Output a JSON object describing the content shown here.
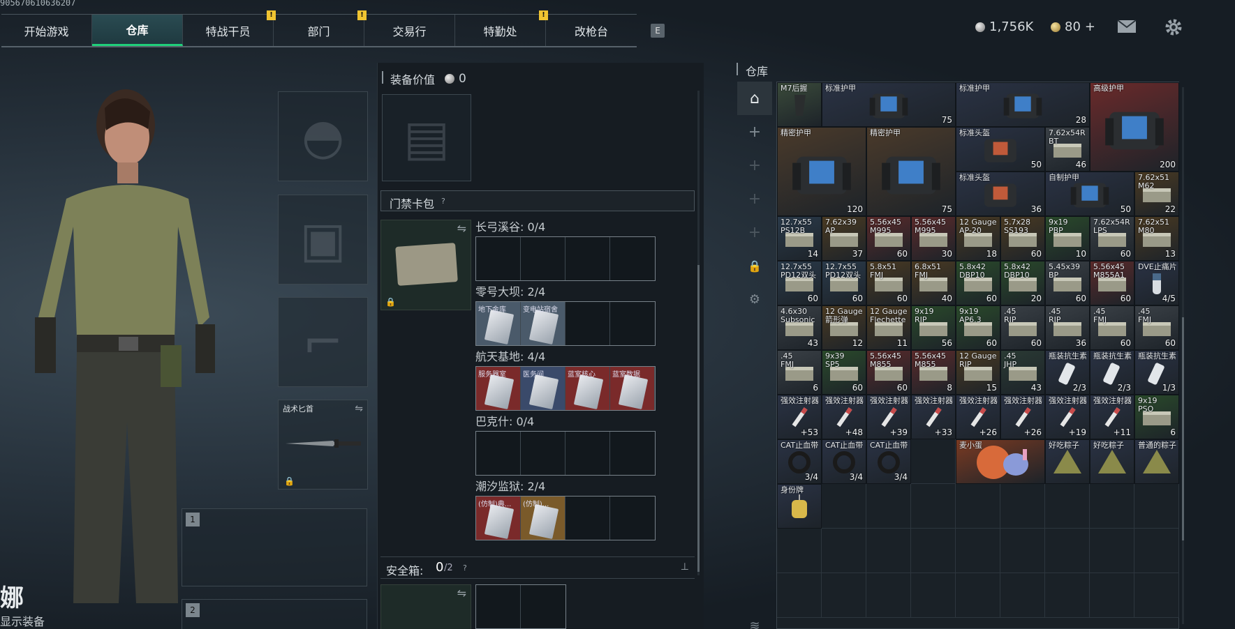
{
  "uid": "905670610636207",
  "tabs": [
    {
      "label": "开始游戏",
      "active": false,
      "alert": false
    },
    {
      "label": "仓库",
      "active": true,
      "alert": false
    },
    {
      "label": "特战干员",
      "active": false,
      "alert": true
    },
    {
      "label": "部门",
      "active": false,
      "alert": true
    },
    {
      "label": "交易行",
      "active": false,
      "alert": false
    },
    {
      "label": "特勤处",
      "active": false,
      "alert": true
    },
    {
      "label": "改枪台",
      "active": false,
      "alert": false
    }
  ],
  "key_hint": "E",
  "currency": {
    "silver": "1,756K",
    "gold": "80",
    "gold_add": "+"
  },
  "character": {
    "name_partial": "娜",
    "subtitle": "显示装备"
  },
  "gear": {
    "knife_label": "战术匕首",
    "weapon_slot_1": "1",
    "weapon_slot_2": "2"
  },
  "middle": {
    "equip_value_label": "装备价值",
    "equip_value": "0",
    "keycard_title": "门禁卡包",
    "help": "?",
    "maps": [
      {
        "label": "长弓溪谷: 0/4",
        "cards": []
      },
      {
        "label": "零号大坝: 2/4",
        "cards": [
          {
            "name": "地下金库",
            "color": "#4a5a6a"
          },
          {
            "name": "变电站宿舍",
            "color": "#4a5a6a"
          }
        ]
      },
      {
        "label": "航天基地: 4/4",
        "cards": [
          {
            "name": "服务器室",
            "color": "#7a2a2a"
          },
          {
            "name": "医务间",
            "color": "#3a4a6a"
          },
          {
            "name": "蓝室核心",
            "color": "#7a2a2a"
          },
          {
            "name": "蓝室数据",
            "color": "#7a2a2a"
          }
        ]
      },
      {
        "label": "巴克什: 0/4",
        "cards": []
      },
      {
        "label": "潮汐监狱: 2/4",
        "cards": [
          {
            "name": "(仿制)典...",
            "color": "#7a2a2a"
          },
          {
            "name": "(仿制)...",
            "color": "#7a5a2a"
          }
        ]
      }
    ],
    "safebox_label": "安全箱:",
    "safebox_value": "0",
    "safebox_total": "/2"
  },
  "warehouse": {
    "title": "仓库",
    "items": [
      {
        "name": "M7后握",
        "qty": "",
        "col": 0,
        "row": 0,
        "w": 1,
        "h": 1,
        "color": "#3a4a3a",
        "icon": "grip"
      },
      {
        "name": "标准护甲",
        "qty": "75",
        "col": 1,
        "row": 0,
        "w": 3,
        "h": 1,
        "color": "#2a3244",
        "icon": "armor"
      },
      {
        "name": "标准护甲",
        "qty": "28",
        "col": 4,
        "row": 0,
        "w": 3,
        "h": 1,
        "color": "#2a3244",
        "icon": "armor"
      },
      {
        "name": "高级护甲",
        "qty": "200",
        "col": 7,
        "row": 0,
        "w": 2,
        "h": 2,
        "color": "#6a2a2a",
        "icon": "armor"
      },
      {
        "name": "精密护甲",
        "qty": "120",
        "col": 0,
        "row": 1,
        "w": 2,
        "h": 2,
        "color": "#4a3a2a",
        "icon": "armor"
      },
      {
        "name": "精密护甲",
        "qty": "75",
        "col": 2,
        "row": 1,
        "w": 2,
        "h": 2,
        "color": "#4a3a2a",
        "icon": "armor"
      },
      {
        "name": "标准头盔",
        "qty": "50",
        "col": 4,
        "row": 1,
        "w": 2,
        "h": 1,
        "color": "#2a3244",
        "icon": "helmet"
      },
      {
        "name": "7.62x54R\nBT",
        "qty": "46",
        "col": 6,
        "row": 1,
        "w": 1,
        "h": 1,
        "color": "#3a4046",
        "icon": "ammo"
      },
      {
        "name": "标准头盔",
        "qty": "36",
        "col": 4,
        "row": 2,
        "w": 2,
        "h": 1,
        "color": "#2a3244",
        "icon": "helmet"
      },
      {
        "name": "自制护甲",
        "qty": "50",
        "col": 6,
        "row": 2,
        "w": 2,
        "h": 1,
        "color": "#2a3244",
        "icon": "armor"
      },
      {
        "name": "7.62x51\nM62",
        "qty": "22",
        "col": 8,
        "row": 2,
        "w": 1,
        "h": 1,
        "color": "#4a3a22",
        "icon": "ammo"
      },
      {
        "name": "12.7x55\nPS12B",
        "qty": "14",
        "col": 0,
        "row": 3,
        "w": 1,
        "h": 1,
        "color": "#2a3a4a",
        "icon": "ammo"
      },
      {
        "name": "7.62x39\nAP",
        "qty": "37",
        "col": 1,
        "row": 3,
        "w": 1,
        "h": 1,
        "color": "#4a3a22",
        "icon": "ammo"
      },
      {
        "name": "5.56x45\nM995",
        "qty": "60",
        "col": 2,
        "row": 3,
        "w": 1,
        "h": 1,
        "color": "#5a2a2a",
        "icon": "ammo"
      },
      {
        "name": "5.56x45\nM995",
        "qty": "30",
        "col": 3,
        "row": 3,
        "w": 1,
        "h": 1,
        "color": "#5a2a2a",
        "icon": "ammo"
      },
      {
        "name": "12 Gauge\nAP-20",
        "qty": "18",
        "col": 4,
        "row": 3,
        "w": 1,
        "h": 1,
        "color": "#4a3a22",
        "icon": "ammo"
      },
      {
        "name": "5.7x28\nSS193",
        "qty": "60",
        "col": 5,
        "row": 3,
        "w": 1,
        "h": 1,
        "color": "#4a3a22",
        "icon": "ammo"
      },
      {
        "name": "9x19\nPBP",
        "qty": "10",
        "col": 6,
        "row": 3,
        "w": 1,
        "h": 1,
        "color": "#2a4a2a",
        "icon": "ammo"
      },
      {
        "name": "7.62x54R\nLPS",
        "qty": "60",
        "col": 7,
        "row": 3,
        "w": 1,
        "h": 1,
        "color": "#3a4046",
        "icon": "ammo"
      },
      {
        "name": "7.62x51\nM80",
        "qty": "13",
        "col": 8,
        "row": 3,
        "w": 1,
        "h": 1,
        "color": "#4a3a22",
        "icon": "ammo"
      },
      {
        "name": "12.7x55\nPD12双头",
        "qty": "60",
        "col": 0,
        "row": 4,
        "w": 1,
        "h": 1,
        "color": "#2a3a4a",
        "icon": "ammo"
      },
      {
        "name": "12.7x55\nPD12双头",
        "qty": "60",
        "col": 1,
        "row": 4,
        "w": 1,
        "h": 1,
        "color": "#2a3a4a",
        "icon": "ammo"
      },
      {
        "name": "5.8x51\nFMJ",
        "qty": "60",
        "col": 2,
        "row": 4,
        "w": 1,
        "h": 1,
        "color": "#4a3a22",
        "icon": "ammo"
      },
      {
        "name": "6.8x51\nFMJ",
        "qty": "40",
        "col": 3,
        "row": 4,
        "w": 1,
        "h": 1,
        "color": "#4a3a22",
        "icon": "ammo"
      },
      {
        "name": "5.8x42\nDBP10",
        "qty": "60",
        "col": 4,
        "row": 4,
        "w": 1,
        "h": 1,
        "color": "#2a4a2a",
        "icon": "ammo"
      },
      {
        "name": "5.8x42\nDBP10",
        "qty": "20",
        "col": 5,
        "row": 4,
        "w": 1,
        "h": 1,
        "color": "#2a4a2a",
        "icon": "ammo"
      },
      {
        "name": "5.45x39\nBP",
        "qty": "60",
        "col": 6,
        "row": 4,
        "w": 1,
        "h": 1,
        "color": "#3a4046",
        "icon": "ammo"
      },
      {
        "name": "5.56x45\nM855A1",
        "qty": "60",
        "col": 7,
        "row": 4,
        "w": 1,
        "h": 1,
        "color": "#5a2a2a",
        "icon": "ammo"
      },
      {
        "name": "DVE止痛片",
        "qty": "4/5",
        "col": 8,
        "row": 4,
        "w": 1,
        "h": 1,
        "color": "#2a3244",
        "icon": "pill"
      },
      {
        "name": "4.6x30\nSubsonic",
        "qty": "43",
        "col": 0,
        "row": 5,
        "w": 1,
        "h": 1,
        "color": "#3a4046",
        "icon": "ammo"
      },
      {
        "name": "12 Gauge\n箭形弹",
        "qty": "12",
        "col": 1,
        "row": 5,
        "w": 1,
        "h": 1,
        "color": "#4a3a22",
        "icon": "ammo"
      },
      {
        "name": "12 Gauge\nFlechette",
        "qty": "11",
        "col": 2,
        "row": 5,
        "w": 1,
        "h": 1,
        "color": "#4a3a22",
        "icon": "ammo"
      },
      {
        "name": "9x19\nRIP",
        "qty": "56",
        "col": 3,
        "row": 5,
        "w": 1,
        "h": 1,
        "color": "#2a4a2a",
        "icon": "ammo"
      },
      {
        "name": "9x19\nAP6.3",
        "qty": "60",
        "col": 4,
        "row": 5,
        "w": 1,
        "h": 1,
        "color": "#2a4a2a",
        "icon": "ammo"
      },
      {
        "name": ".45\nRIP",
        "qty": "60",
        "col": 5,
        "row": 5,
        "w": 1,
        "h": 1,
        "color": "#3a4046",
        "icon": "ammo"
      },
      {
        "name": ".45\nRIP",
        "qty": "36",
        "col": 6,
        "row": 5,
        "w": 1,
        "h": 1,
        "color": "#3a4046",
        "icon": "ammo"
      },
      {
        "name": ".45\nFMJ",
        "qty": "60",
        "col": 7,
        "row": 5,
        "w": 1,
        "h": 1,
        "color": "#3a4046",
        "icon": "ammo"
      },
      {
        "name": ".45\nFMJ",
        "qty": "60",
        "col": 8,
        "row": 5,
        "w": 1,
        "h": 1,
        "color": "#3a4046",
        "icon": "ammo"
      },
      {
        "name": ".45\nFMJ",
        "qty": "6",
        "col": 0,
        "row": 6,
        "w": 1,
        "h": 1,
        "color": "#3a4046",
        "icon": "ammo"
      },
      {
        "name": "9x39\nSP5",
        "qty": "60",
        "col": 1,
        "row": 6,
        "w": 1,
        "h": 1,
        "color": "#2a4a2a",
        "icon": "ammo"
      },
      {
        "name": "5.56x45\nM855",
        "qty": "60",
        "col": 2,
        "row": 6,
        "w": 1,
        "h": 1,
        "color": "#5a2a2a",
        "icon": "ammo"
      },
      {
        "name": "5.56x45\nM855",
        "qty": "8",
        "col": 3,
        "row": 6,
        "w": 1,
        "h": 1,
        "color": "#5a2a2a",
        "icon": "ammo"
      },
      {
        "name": "12 Gauge\nRIP",
        "qty": "15",
        "col": 4,
        "row": 6,
        "w": 1,
        "h": 1,
        "color": "#4a3a22",
        "icon": "ammo"
      },
      {
        "name": ".45\nJHP",
        "qty": "43",
        "col": 5,
        "row": 6,
        "w": 1,
        "h": 1,
        "color": "#2a3a34",
        "icon": "ammo"
      },
      {
        "name": "瓶装抗生素",
        "qty": "2/3",
        "col": 6,
        "row": 6,
        "w": 1,
        "h": 1,
        "color": "#2a3244",
        "icon": "bottle"
      },
      {
        "name": "瓶装抗生素",
        "qty": "2/3",
        "col": 7,
        "row": 6,
        "w": 1,
        "h": 1,
        "color": "#2a3244",
        "icon": "bottle"
      },
      {
        "name": "瓶装抗生素",
        "qty": "1/3",
        "col": 8,
        "row": 6,
        "w": 1,
        "h": 1,
        "color": "#2a3244",
        "icon": "bottle"
      },
      {
        "name": "强效注射器",
        "qty": "+53",
        "col": 0,
        "row": 7,
        "w": 1,
        "h": 1,
        "color": "#2a3244",
        "icon": "syringe"
      },
      {
        "name": "强效注射器",
        "qty": "+48",
        "col": 1,
        "row": 7,
        "w": 1,
        "h": 1,
        "color": "#2a3244",
        "icon": "syringe"
      },
      {
        "name": "强效注射器",
        "qty": "+39",
        "col": 2,
        "row": 7,
        "w": 1,
        "h": 1,
        "color": "#2a3244",
        "icon": "syringe"
      },
      {
        "name": "强效注射器",
        "qty": "+33",
        "col": 3,
        "row": 7,
        "w": 1,
        "h": 1,
        "color": "#2a3244",
        "icon": "syringe"
      },
      {
        "name": "强效注射器",
        "qty": "+26",
        "col": 4,
        "row": 7,
        "w": 1,
        "h": 1,
        "color": "#2a3244",
        "icon": "syringe"
      },
      {
        "name": "强效注射器",
        "qty": "+26",
        "col": 5,
        "row": 7,
        "w": 1,
        "h": 1,
        "color": "#2a3244",
        "icon": "syringe"
      },
      {
        "name": "强效注射器",
        "qty": "+19",
        "col": 6,
        "row": 7,
        "w": 1,
        "h": 1,
        "color": "#2a3244",
        "icon": "syringe"
      },
      {
        "name": "强效注射器",
        "qty": "+11",
        "col": 7,
        "row": 7,
        "w": 1,
        "h": 1,
        "color": "#2a3244",
        "icon": "syringe"
      },
      {
        "name": "9x19\nPSO",
        "qty": "6",
        "col": 8,
        "row": 7,
        "w": 1,
        "h": 1,
        "color": "#2a4a2a",
        "icon": "ammo"
      },
      {
        "name": "CAT止血带",
        "qty": "3/4",
        "col": 0,
        "row": 8,
        "w": 1,
        "h": 1,
        "color": "#2a3244",
        "icon": "tourniquet"
      },
      {
        "name": "CAT止血带",
        "qty": "3/4",
        "col": 1,
        "row": 8,
        "w": 1,
        "h": 1,
        "color": "#2a3244",
        "icon": "tourniquet"
      },
      {
        "name": "CAT止血带",
        "qty": "3/4",
        "col": 2,
        "row": 8,
        "w": 1,
        "h": 1,
        "color": "#2a3244",
        "icon": "tourniquet"
      },
      {
        "name": "麦小蛋",
        "qty": "",
        "col": 4,
        "row": 8,
        "w": 2,
        "h": 1,
        "color": "#7a3a22",
        "icon": "toy"
      },
      {
        "name": "好吃粽子",
        "qty": "",
        "col": 6,
        "row": 8,
        "w": 1,
        "h": 1,
        "color": "#2a3244",
        "icon": "zongzi"
      },
      {
        "name": "好吃粽子",
        "qty": "",
        "col": 7,
        "row": 8,
        "w": 1,
        "h": 1,
        "color": "#2a3244",
        "icon": "zongzi"
      },
      {
        "name": "普通的粽子",
        "qty": "",
        "col": 8,
        "row": 8,
        "w": 1,
        "h": 1,
        "color": "#2a3244",
        "icon": "zongzi"
      },
      {
        "name": "身份牌",
        "qty": "",
        "col": 0,
        "row": 9,
        "w": 1,
        "h": 1,
        "color": "#2a3244",
        "icon": "dogtag"
      }
    ]
  }
}
